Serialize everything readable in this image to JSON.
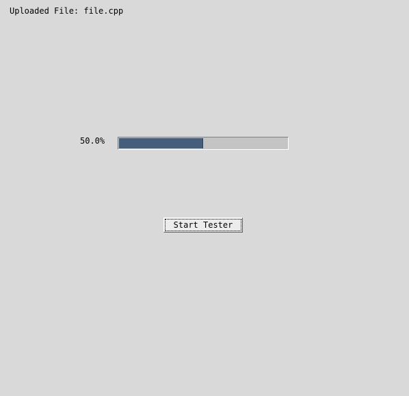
{
  "file": {
    "uploaded_label": "Uploaded File: file.cpp"
  },
  "progress": {
    "label": "50.0%",
    "value": 0.5,
    "fill_color": "#475e7b",
    "track_color": "#c4c4c4"
  },
  "actions": {
    "start_label": "Start Tester"
  },
  "colors": {
    "background": "#d9d9d9"
  }
}
